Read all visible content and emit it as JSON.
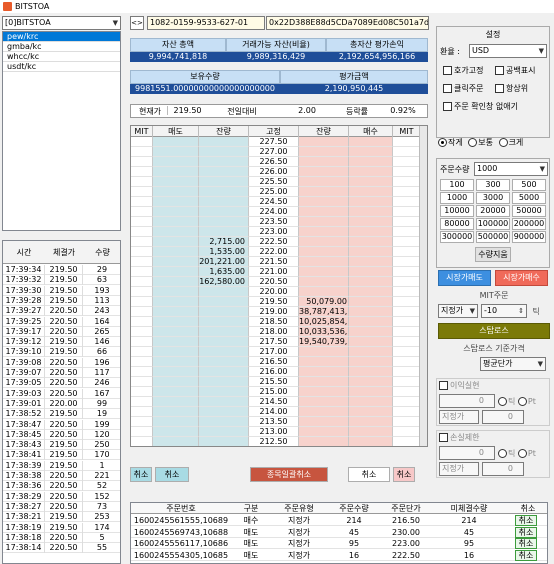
{
  "window_title": "BITSTOA",
  "account_select": "[0]BITSTOA",
  "coin_list": [
    "pew/krc",
    "gmba/kc",
    "whcc/kc",
    "usdt/kc"
  ],
  "wallet": {
    "address1": "1082-0159-9533-627-01",
    "address2": "0x22D388E88d5CDa7089Ed08C501a7dF38DBF4953C"
  },
  "summary": {
    "h_total": "자산 총액",
    "h_available": "거래가능 자산(비율)",
    "h_pl": "총자산 평가손익",
    "v_total": "9,994,741,818",
    "v_available": "9,989,316,429",
    "v_pl": "2,192,654,956,166",
    "h_holding": "보유수량",
    "h_eval": "평가금액",
    "v_holding": "9981551.00000000000000000000",
    "v_eval": "2,190,950,445"
  },
  "price_bar": {
    "cur_label": "현재가",
    "cur": "219.50",
    "chg_label": "전일대비",
    "chg": "2.00",
    "rate_label": "등락률",
    "rate": "0.92%"
  },
  "orderbook_header": [
    "MIT",
    "매도",
    "잔량",
    "고정",
    "잔량",
    "매수",
    "MIT"
  ],
  "orderbook": [
    {
      "p": "227.50",
      "s": "",
      "b": ""
    },
    {
      "p": "227.00",
      "s": "",
      "b": ""
    },
    {
      "p": "226.50",
      "s": "",
      "b": ""
    },
    {
      "p": "226.00",
      "s": "",
      "b": ""
    },
    {
      "p": "225.50",
      "s": "",
      "b": ""
    },
    {
      "p": "225.00",
      "s": "",
      "b": ""
    },
    {
      "p": "224.50",
      "s": "",
      "b": ""
    },
    {
      "p": "224.00",
      "s": "",
      "b": ""
    },
    {
      "p": "223.50",
      "s": "",
      "b": ""
    },
    {
      "p": "223.00",
      "s": "",
      "b": ""
    },
    {
      "p": "222.50",
      "s": "2,715.00",
      "b": ""
    },
    {
      "p": "222.00",
      "s": "1,535.00",
      "b": ""
    },
    {
      "p": "221.50",
      "s": "201,221.00",
      "b": ""
    },
    {
      "p": "221.00",
      "s": "1,635.00",
      "b": ""
    },
    {
      "p": "220.50",
      "s": "162,580.00",
      "b": ""
    },
    {
      "p": "220.00",
      "s": "",
      "b": ""
    },
    {
      "p": "219.50",
      "s": "",
      "b": "50,079.00"
    },
    {
      "p": "219.00",
      "s": "",
      "b": "38,787,413,..."
    },
    {
      "p": "218.50",
      "s": "",
      "b": "10,025,854,..."
    },
    {
      "p": "218.00",
      "s": "",
      "b": "10,033,536,..."
    },
    {
      "p": "217.50",
      "s": "",
      "b": "19,540,739,..."
    },
    {
      "p": "217.00",
      "s": "",
      "b": ""
    },
    {
      "p": "216.50",
      "s": "",
      "b": ""
    },
    {
      "p": "216.00",
      "s": "",
      "b": ""
    },
    {
      "p": "215.50",
      "s": "",
      "b": ""
    },
    {
      "p": "215.00",
      "s": "",
      "b": ""
    },
    {
      "p": "214.50",
      "s": "",
      "b": ""
    },
    {
      "p": "214.00",
      "s": "",
      "b": ""
    },
    {
      "p": "213.50",
      "s": "",
      "b": ""
    },
    {
      "p": "213.00",
      "s": "",
      "b": ""
    },
    {
      "p": "212.50",
      "s": "",
      "b": ""
    }
  ],
  "ob_buttons": {
    "cancel1": "취소",
    "cancel2": "취소",
    "cancel_all": "종목일괄취소",
    "cancel3": "취소",
    "cancel4": "취소"
  },
  "trades_header": [
    "시간",
    "체결가",
    "수량"
  ],
  "trades": [
    [
      "17:39:34",
      "219.50",
      "29"
    ],
    [
      "17:39:32",
      "219.50",
      "63"
    ],
    [
      "17:39:30",
      "219.50",
      "193"
    ],
    [
      "17:39:28",
      "219.50",
      "113"
    ],
    [
      "17:39:27",
      "220.50",
      "243"
    ],
    [
      "17:39:25",
      "220.50",
      "164"
    ],
    [
      "17:39:17",
      "220.50",
      "265"
    ],
    [
      "17:39:12",
      "219.50",
      "146"
    ],
    [
      "17:39:10",
      "219.50",
      "66"
    ],
    [
      "17:39:08",
      "220.50",
      "196"
    ],
    [
      "17:39:07",
      "220.50",
      "117"
    ],
    [
      "17:39:05",
      "220.50",
      "246"
    ],
    [
      "17:39:03",
      "220.50",
      "167"
    ],
    [
      "17:39:01",
      "220.00",
      "99"
    ],
    [
      "17:38:52",
      "219.50",
      "19"
    ],
    [
      "17:38:47",
      "220.50",
      "199"
    ],
    [
      "17:38:45",
      "220.50",
      "120"
    ],
    [
      "17:38:43",
      "219.50",
      "250"
    ],
    [
      "17:38:41",
      "219.50",
      "170"
    ],
    [
      "17:38:39",
      "219.50",
      "1"
    ],
    [
      "17:38:38",
      "220.50",
      "221"
    ],
    [
      "17:38:36",
      "220.50",
      "52"
    ],
    [
      "17:38:29",
      "220.50",
      "152"
    ],
    [
      "17:38:27",
      "220.50",
      "73"
    ],
    [
      "17:38:21",
      "219.50",
      "253"
    ],
    [
      "17:38:19",
      "219.50",
      "174"
    ],
    [
      "17:38:18",
      "220.50",
      "5"
    ],
    [
      "17:38:14",
      "220.50",
      "55"
    ]
  ],
  "settings": {
    "title": "설정",
    "currency_label": "환율 :",
    "currency": "USD",
    "cb_fix": "호가고정",
    "cb_space": "공백표시",
    "cb_click": "클릭주문",
    "cb_top": "항상위",
    "cb_confirm": "주문 확인창 없애기",
    "size_small": "작게",
    "size_normal": "보통",
    "size_large": "크게",
    "qty_label": "주문수량",
    "qty": "1000",
    "qty_buttons": [
      "100",
      "300",
      "500",
      "1000",
      "3000",
      "5000",
      "10000",
      "20000",
      "50000",
      "80000",
      "100000",
      "200000",
      "300000",
      "500000",
      "900000"
    ],
    "qty_reset": "수량지움",
    "market_sell": "시장가매도",
    "market_buy": "시장가매수",
    "mit_label": "MIT주문",
    "mit_type": "지정가",
    "mit_tick": "-10",
    "tick": "틱",
    "stoploss": "스탑로스",
    "stoploss_basis_label": "스탑로스 기준가격",
    "stoploss_basis": "평균단가",
    "profit_label": "이익실현",
    "loss_label": "손실제한",
    "pt": "Pt",
    "zero": "0",
    "limit": "지정가"
  },
  "orders_header": [
    "주문번호",
    "구분",
    "주문유형",
    "주문수량",
    "주문단가",
    "미체결수량",
    "취소"
  ],
  "orders": [
    [
      "1600245561555,10689",
      "매수",
      "지정가",
      "214",
      "216.50",
      "214",
      "취소"
    ],
    [
      "1600245569743,10688",
      "매도",
      "지정가",
      "45",
      "230.00",
      "45",
      "취소"
    ],
    [
      "1600245556117,10686",
      "매도",
      "지정가",
      "95",
      "223.00",
      "95",
      "취소"
    ],
    [
      "1600245554305,10685",
      "매도",
      "지정가",
      "16",
      "222.50",
      "16",
      "취소"
    ]
  ],
  "colors": {
    "ask_bg": "#cde6ea",
    "bid_bg": "#f7d2cc",
    "market_sell": "#3d8fe0",
    "market_buy": "#f06a5a",
    "stoploss": "#7b7a08"
  }
}
